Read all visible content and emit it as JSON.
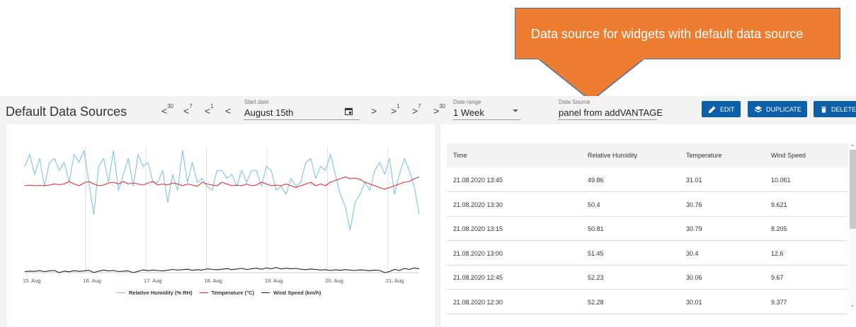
{
  "callout": {
    "text": "Data source for widgets with default data source"
  },
  "header": {
    "title": "Default Data Sources",
    "nav_back": [
      {
        "label": "<",
        "sup": "30"
      },
      {
        "label": "<",
        "sup": "7"
      },
      {
        "label": "<",
        "sup": "1"
      },
      {
        "label": "<",
        "sup": ""
      }
    ],
    "nav_forward": [
      {
        "label": ">",
        "sup": ""
      },
      {
        "label": ">",
        "sup": "1"
      },
      {
        "label": ">",
        "sup": "7"
      },
      {
        "label": ">",
        "sup": "30"
      }
    ],
    "start_date": {
      "label": "Start date",
      "value": "August 15th",
      "icon": "calendar-icon"
    },
    "date_range": {
      "label": "Date range",
      "value": "1 Week",
      "icon": "dropdown-arrow-icon"
    },
    "data_source": {
      "label": "Data Source",
      "value": "panel from addVANTAGE"
    },
    "buttons": {
      "edit": {
        "label": "EDIT",
        "icon": "pencil-icon"
      },
      "duplicate": {
        "label": "DUPLICATE",
        "icon": "layers-icon"
      },
      "delete": {
        "label": "DELETE",
        "icon": "trash-icon"
      }
    }
  },
  "chart_data": {
    "type": "line",
    "title": "",
    "xlabel": "",
    "ylabel": "",
    "x_ticks": [
      "15. Aug",
      "16. Aug",
      "17. Aug",
      "18. Aug",
      "19. Aug",
      "20. Aug",
      "21. Aug"
    ],
    "grid": "vertical",
    "legend_position": "bottom-center",
    "series": [
      {
        "name": "Relative Humidity (% RH)",
        "color": "#7ec3e6",
        "values": [
          0.8,
          0.95,
          0.7,
          0.9,
          0.55,
          0.85,
          0.9,
          0.75,
          0.85,
          0.6,
          0.95,
          0.85,
          1.0,
          0.6,
          0.2,
          0.8,
          0.9,
          0.6,
          1.0,
          0.5,
          0.7,
          0.9,
          0.55,
          0.95,
          0.8,
          0.85,
          0.6,
          0.6,
          0.75,
          0.35,
          0.7,
          0.5,
          1.0,
          0.6,
          0.85,
          0.6,
          0.65,
          0.55,
          0.5,
          0.75,
          0.75,
          0.65,
          0.7,
          0.55,
          0.75,
          0.6,
          0.75,
          0.75,
          0.55,
          0.8,
          0.75,
          0.5,
          0.55,
          0.45,
          0.65,
          0.55,
          0.6,
          0.85,
          0.9,
          0.65,
          0.8,
          0.75,
          0.95,
          0.7,
          0.45,
          0.3,
          0.0,
          0.35,
          0.45,
          0.6,
          0.5,
          0.75,
          0.85,
          0.7,
          0.9,
          0.45,
          0.7,
          0.9,
          0.75,
          0.55,
          0.2
        ]
      },
      {
        "name": "Temperature (°C)",
        "color": "#e0302e",
        "values": [
          0.5,
          0.52,
          0.5,
          0.51,
          0.5,
          0.52,
          0.55,
          0.53,
          0.55,
          0.62,
          0.55,
          0.5,
          0.58,
          0.62,
          0.55,
          0.5,
          0.52,
          0.58,
          0.6,
          0.55,
          0.62,
          0.55,
          0.58,
          0.55,
          0.52,
          0.58,
          0.62,
          0.52,
          0.55,
          0.52,
          0.58,
          0.55,
          0.5,
          0.55,
          0.52,
          0.48,
          0.6,
          0.55,
          0.52,
          0.5,
          0.6,
          0.55,
          0.5,
          0.52,
          0.5,
          0.55,
          0.5,
          0.52,
          0.6,
          0.55,
          0.5,
          0.52,
          0.5,
          0.55,
          0.5,
          0.45,
          0.5,
          0.55,
          0.6,
          0.5,
          0.55,
          0.5,
          0.6,
          0.65,
          0.7,
          0.75,
          0.7,
          0.72,
          0.68,
          0.6,
          0.55,
          0.5,
          0.45,
          0.4,
          0.45,
          0.5,
          0.55,
          0.6,
          0.62,
          0.7,
          0.75
        ]
      },
      {
        "name": "Wind Speed (km/h)",
        "color": "#222222",
        "values": [
          0.05,
          0.07,
          0.06,
          0.09,
          0.05,
          0.08,
          0.1,
          0.0,
          0.07,
          0.04,
          0.09,
          0.06,
          0.08,
          0.11,
          0.0,
          0.07,
          0.12,
          0.08,
          0.1,
          0.05,
          0.07,
          0.08,
          0.0,
          0.06,
          0.13,
          0.09,
          0.12,
          0.1,
          0.08,
          0.11,
          0.15,
          0.12,
          0.14,
          0.16,
          0.11,
          0.14,
          0.12,
          0.18,
          0.15,
          0.13,
          0.16,
          0.19,
          0.14,
          0.17,
          0.2,
          0.15,
          0.18,
          0.21,
          0.16,
          0.22,
          0.18,
          0.24,
          0.17,
          0.21,
          0.18,
          0.2,
          0.16,
          0.14,
          0.17,
          0.15,
          0.12,
          0.14,
          0.1,
          0.13,
          0.11,
          0.14,
          0.12,
          0.1,
          0.13,
          0.11,
          0.09,
          0.12,
          0.1,
          0.0,
          0.05,
          0.15,
          0.1,
          0.2,
          0.15,
          0.22,
          0.18
        ]
      }
    ]
  },
  "table": {
    "columns": [
      "Time",
      "Relative Humidity",
      "Temperature",
      "Wind Speed"
    ],
    "rows": [
      [
        "21.08.2020 13:45",
        "49.86",
        "31.01",
        "10.061"
      ],
      [
        "21.08.2020 13:30",
        "50.4",
        "30.76",
        "9.621"
      ],
      [
        "21.08.2020 13:15",
        "50.81",
        "30.79",
        "8.205"
      ],
      [
        "21.08.2020 13:00",
        "51.45",
        "30.4",
        "12.6"
      ],
      [
        "21.08.2020 12:45",
        "52.23",
        "30.06",
        "9.67"
      ],
      [
        "21.08.2020 12:30",
        "52.28",
        "30.01",
        "9.377"
      ]
    ]
  }
}
